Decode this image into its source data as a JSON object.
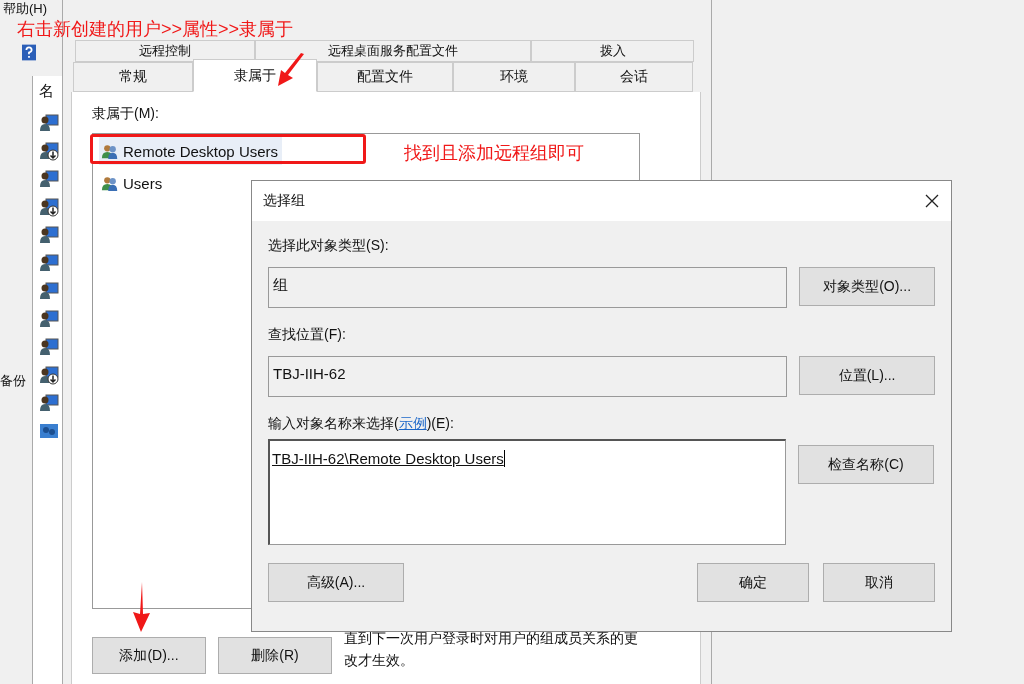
{
  "background_window": {
    "menu_item": "帮助(H)",
    "column_header": "名",
    "side_text": "备份",
    "rows": [
      {
        "kind": "user",
        "disabled": false
      },
      {
        "kind": "user",
        "disabled": true
      },
      {
        "kind": "user",
        "disabled": false
      },
      {
        "kind": "user",
        "disabled": true
      },
      {
        "kind": "user",
        "disabled": false
      },
      {
        "kind": "user",
        "disabled": false
      },
      {
        "kind": "user",
        "disabled": false
      },
      {
        "kind": "user",
        "disabled": false
      },
      {
        "kind": "user",
        "disabled": false
      },
      {
        "kind": "user",
        "disabled": true
      },
      {
        "kind": "user",
        "disabled": false
      },
      {
        "kind": "group",
        "disabled": false
      }
    ]
  },
  "properties_dialog": {
    "tabs_row_1": [
      {
        "label": "远程控制",
        "selected": false
      },
      {
        "label": "远程桌面服务配置文件",
        "selected": false
      },
      {
        "label": "拨入",
        "selected": false
      }
    ],
    "tabs_row_2": [
      {
        "label": "常规",
        "selected": false
      },
      {
        "label": "隶属于",
        "selected": true
      },
      {
        "label": "配置文件",
        "selected": false
      },
      {
        "label": "环境",
        "selected": false
      },
      {
        "label": "会话",
        "selected": false
      }
    ],
    "member_of_label": "隶属于(M):",
    "members": [
      {
        "name": "Remote Desktop Users",
        "selected": true
      },
      {
        "name": "Users",
        "selected": false
      }
    ],
    "add_button": "添加(D)...",
    "remove_button": "删除(R)",
    "note": "直到下一次用户登录时对用户的组成员关系的更改才生效。"
  },
  "select_group_dialog": {
    "title": "选择组",
    "object_type_label": "选择此对象类型(S):",
    "object_type_value": "组",
    "object_type_button": "对象类型(O)...",
    "location_label": "查找位置(F):",
    "location_value": "TBJ-IIH-62",
    "location_button": "位置(L)...",
    "names_label_before": "输入对象名称来选择(",
    "names_label_link": "示例",
    "names_label_after": ")(E):",
    "names_value": "TBJ-IIH-62\\Remote Desktop Users",
    "check_button": "检查名称(C)",
    "advanced_button": "高级(A)...",
    "ok_button": "确定",
    "cancel_button": "取消"
  },
  "annotations": {
    "top_text": "右击新创建的用户>>属性>>隶属于",
    "side_text": "找到且添加远程组即可"
  }
}
